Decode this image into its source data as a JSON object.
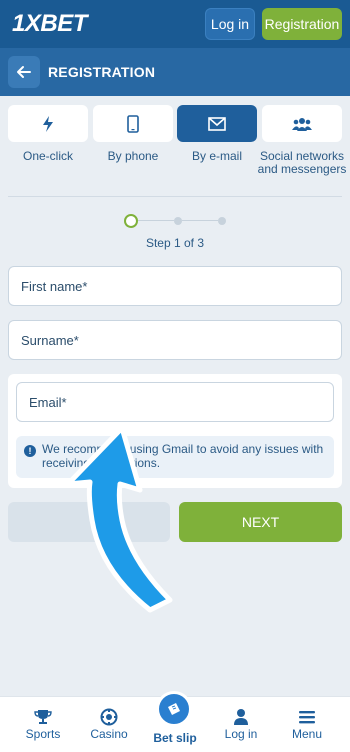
{
  "header": {
    "logo_prefix": "1X",
    "logo_suffix": "BET",
    "login_label": "Log in",
    "register_label": "Registration"
  },
  "subheader": {
    "title": "REGISTRATION"
  },
  "methods": [
    {
      "label": "One-click",
      "icon": "lightning-icon"
    },
    {
      "label": "By phone",
      "icon": "phone-icon"
    },
    {
      "label": "By e-mail",
      "icon": "envelope-icon",
      "active": true
    },
    {
      "label": "Social networks and messengers",
      "icon": "users-icon"
    }
  ],
  "steps": {
    "text": "Step 1 of 3",
    "current": 1,
    "total": 3
  },
  "form": {
    "first_name_placeholder": "First name*",
    "surname_placeholder": "Surname*",
    "email_placeholder": "Email*",
    "notice_text": "We recommend using Gmail to avoid any issues with receiving notifications.",
    "next_label": "NEXT"
  },
  "bottom_nav": [
    {
      "label": "Sports",
      "icon": "trophy-icon"
    },
    {
      "label": "Casino",
      "icon": "casino-chip-icon"
    },
    {
      "label": "Bet slip",
      "icon": "ticket-icon"
    },
    {
      "label": "Log in",
      "icon": "user-icon"
    },
    {
      "label": "Menu",
      "icon": "menu-icon"
    }
  ],
  "colors": {
    "brand_blue": "#1a5a93",
    "accent_green": "#7fb13a",
    "arrow_blue": "#1e9be8"
  }
}
